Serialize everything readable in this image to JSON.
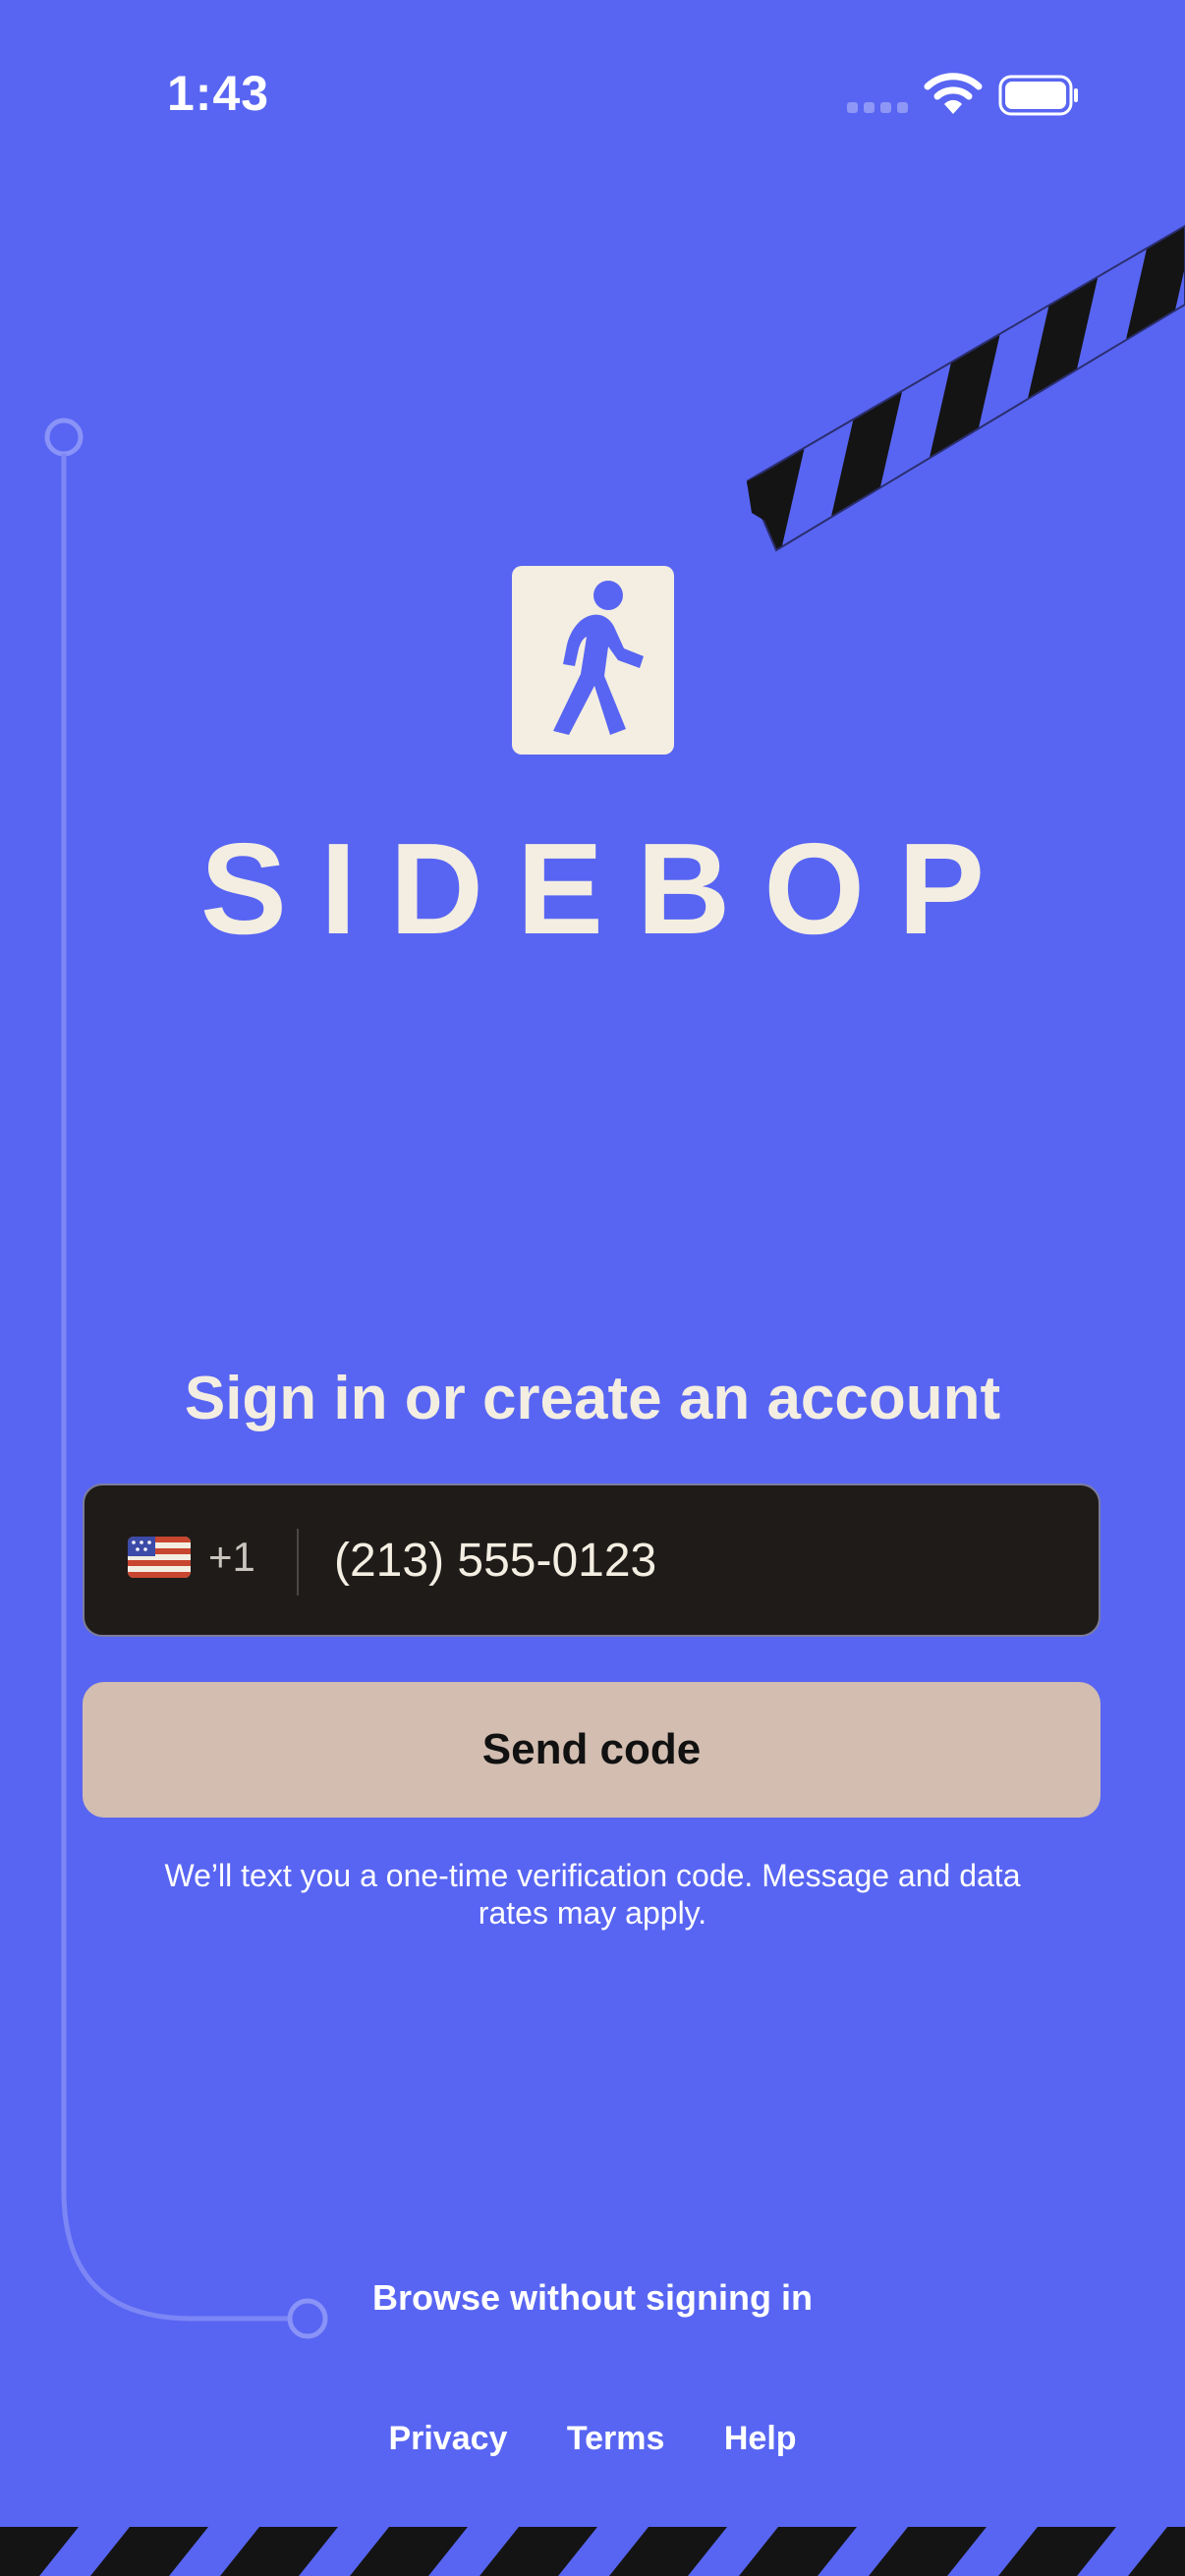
{
  "status_bar": {
    "time": "1:43"
  },
  "brand": {
    "name": "SIDEBOP",
    "logo_icon": "person-walking-icon"
  },
  "signin": {
    "heading": "Sign in or create an account",
    "country_flag_icon": "us-flag-icon",
    "dial_code": "+1",
    "phone_value": "(213) 555-0123",
    "send_label": "Send code",
    "disclaimer": "We’ll text you a one-time verification code. Message and data rates may apply."
  },
  "browse_label": "Browse without signing in",
  "footer": {
    "links": [
      "Privacy",
      "Terms",
      "Help"
    ]
  },
  "colors": {
    "background": "#5865F2",
    "cream": "#F3EEE1",
    "field": "#1E1B19",
    "button": "#D2BDB0"
  }
}
